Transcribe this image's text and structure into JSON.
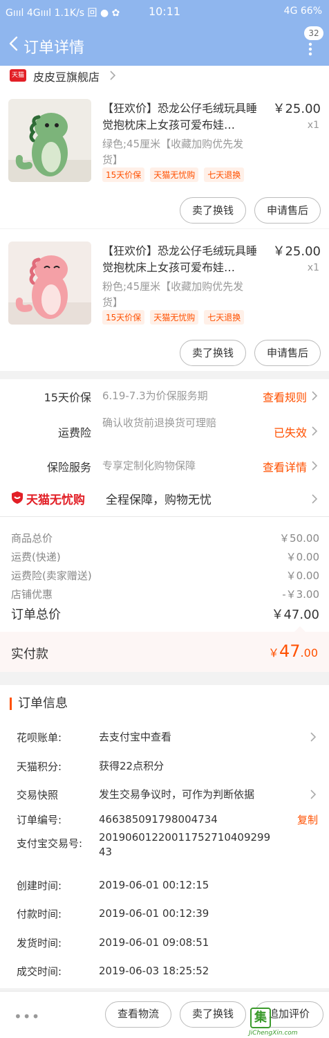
{
  "status_bar": {
    "left": "Gıııl 4Gıııl 1.1K/s 回 ● ✿",
    "time": "10:11",
    "right": "4G 66%"
  },
  "nav": {
    "title": "订单详情",
    "badge": "32"
  },
  "shop": {
    "logo_text": "天猫",
    "name": "皮皮豆旗舰店"
  },
  "items": [
    {
      "title": "【狂欢价】恐龙公仔毛绒玩具睡觉抱枕床上女孩可爱布娃…",
      "sku": "绿色;45厘米【收藏加购优先发货】",
      "price": "￥25.00",
      "qty": "x1",
      "color": "#7cb47a",
      "tags": [
        "15天价保",
        "天猫无忧购",
        "七天退换"
      ],
      "btn_sell": "卖了换钱",
      "btn_aftersale": "申请售后"
    },
    {
      "title": "【狂欢价】恐龙公仔毛绒玩具睡觉抱枕床上女孩可爱布娃…",
      "sku": "粉色;45厘米【收藏加购优先发货】",
      "price": "￥25.00",
      "qty": "x1",
      "color": "#f4a0a6",
      "tags": [
        "15天价保",
        "天猫无忧购",
        "七天退换"
      ],
      "btn_sell": "卖了换钱",
      "btn_aftersale": "申请售后"
    }
  ],
  "services": [
    {
      "label": "15天价保",
      "desc": "6.19-7.3为价保服务期",
      "link": "查看规则"
    },
    {
      "label": "运费险",
      "desc": "确认收货前退换货可理赔",
      "link": "已失效"
    },
    {
      "label": "保险服务",
      "desc": "专享定制化购物保障",
      "link": "查看详情"
    }
  ],
  "assurance": {
    "brand": "天猫无忧购",
    "text": "全程保障，购物无忧"
  },
  "fees": [
    {
      "label": "商品总价",
      "value": "￥50.00"
    },
    {
      "label": "运费(快递)",
      "value": "￥0.00"
    },
    {
      "label": "运费险(卖家赠送)",
      "value": "￥0.00"
    },
    {
      "label": "店铺优惠",
      "value": "-￥3.00"
    }
  ],
  "order_total": {
    "label": "订单总价",
    "value": "￥47.00"
  },
  "paid": {
    "label": "实付款",
    "currency": "￥",
    "integer": "47",
    "decimal": ".00"
  },
  "order_info": {
    "title": "订单信息",
    "rows": [
      {
        "label": "花呗账单:",
        "value": "去支付宝中查看"
      },
      {
        "label": "天猫积分:",
        "value": "获得22点积分"
      },
      {
        "label": "交易快照",
        "value": "发生交易争议时，可作为判断依据"
      },
      {
        "label": "订单编号:",
        "value": "466385091798004734"
      },
      {
        "label": "支付宝交易号:",
        "value": "2019060122001175271040929943"
      },
      {
        "label": "创建时间:",
        "value": "2019-06-01 00:12:15"
      },
      {
        "label": "付款时间:",
        "value": "2019-06-01 00:12:39"
      },
      {
        "label": "发货时间:",
        "value": "2019-06-01 09:08:51"
      },
      {
        "label": "成交时间:",
        "value": "2019-06-03 18:25:52"
      }
    ],
    "copy_label": "复制"
  },
  "bottom_bar": {
    "more": "•••",
    "logistics": "查看物流",
    "sell": "卖了换钱",
    "review": "追加评价"
  },
  "watermark": {
    "char": "集",
    "text": "JiChengXin.com"
  },
  "colors": {
    "header": "#8fb6ee",
    "accent": "#ff5000",
    "tmall_red": "#e21f26"
  }
}
